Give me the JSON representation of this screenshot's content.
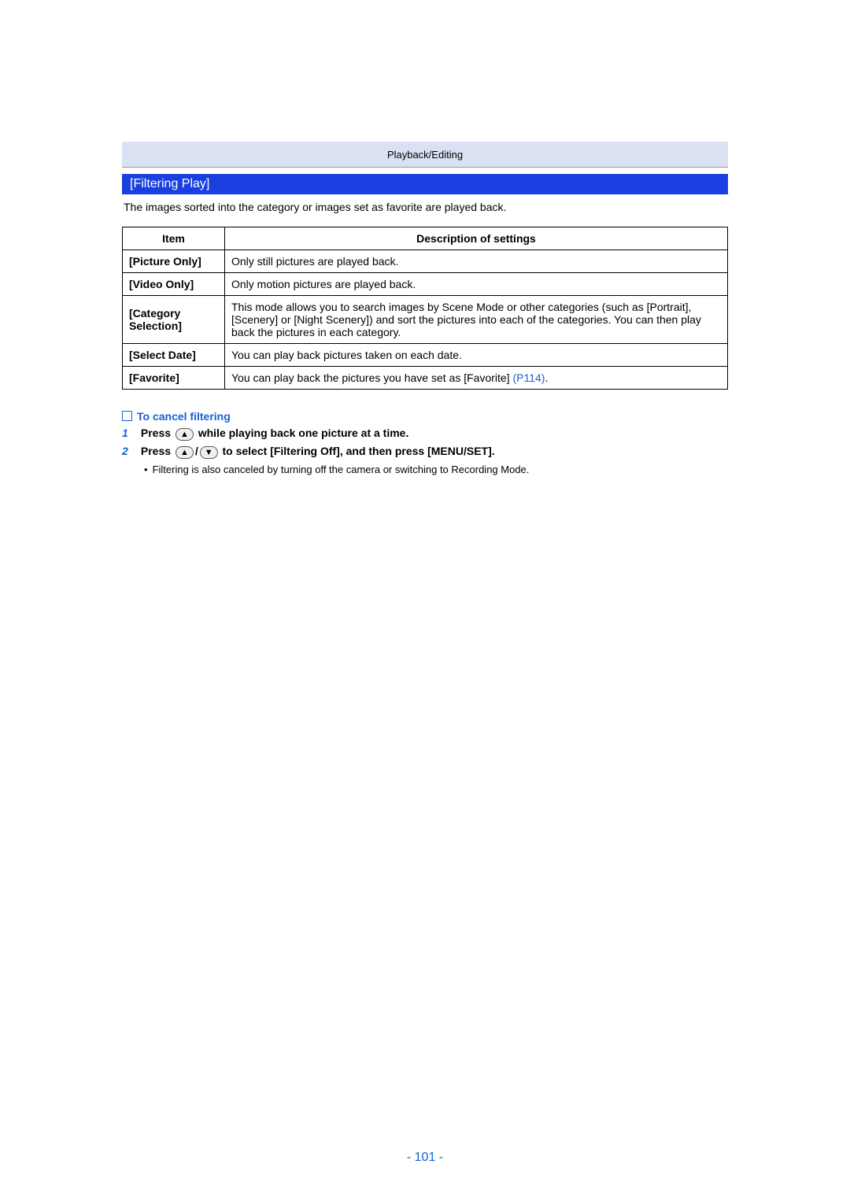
{
  "header": {
    "section": "Playback/Editing",
    "title": "[Filtering Play]"
  },
  "intro": "The images sorted into the category or images set as favorite are played back.",
  "table": {
    "headers": {
      "col1": "Item",
      "col2": "Description of settings"
    },
    "rows": [
      {
        "label": "[Picture Only]",
        "desc": "Only still pictures are played back."
      },
      {
        "label": "[Video Only]",
        "desc": "Only motion pictures are played back."
      },
      {
        "label": "[Category Selection]",
        "desc": "This mode allows you to search images by Scene Mode or other categories (such as [Portrait], [Scenery] or [Night Scenery]) and sort the pictures into each of the categories. You can then play back the pictures in each category."
      },
      {
        "label": "[Select Date]",
        "desc": "You can play back pictures taken on each date."
      },
      {
        "label": "[Favorite]",
        "desc_pre": "You can play back the pictures you have set as [Favorite] ",
        "link": "(P114)",
        "desc_post": "."
      }
    ]
  },
  "cancel": {
    "heading": "To cancel filtering",
    "step1_pre": "Press ",
    "step1_btn": "▲",
    "step1_post": " while playing back one picture at a time.",
    "step2_pre": "Press ",
    "step2_btn1": "▲",
    "step2_mid": "/",
    "step2_btn2": "▼",
    "step2_post": " to select [Filtering Off], and then press [MENU/SET].",
    "note": "Filtering is also canceled by turning off the camera or switching to Recording Mode."
  },
  "page_number": "- 101 -"
}
